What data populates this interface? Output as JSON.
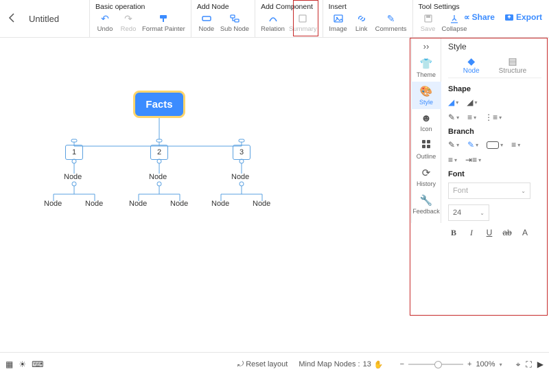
{
  "doc": {
    "title": "Untitled"
  },
  "toolbar": {
    "groups": {
      "basic": {
        "title": "Basic operation",
        "undo": "Undo",
        "redo": "Redo",
        "format_painter": "Format Painter"
      },
      "addnode": {
        "title": "Add Node",
        "node": "Node",
        "sub_node": "Sub Node"
      },
      "addcomp": {
        "title": "Add Component",
        "relation": "Relation",
        "summary": "Summary"
      },
      "insert": {
        "title": "Insert",
        "image": "Image",
        "link": "Link",
        "comments": "Comments"
      },
      "toolset": {
        "title": "Tool Settings",
        "save": "Save",
        "collapse": "Collapse"
      }
    },
    "share": "Share",
    "export": "Export"
  },
  "mindmap": {
    "root": "Facts",
    "children": [
      {
        "id": "1",
        "label": "Node",
        "children": [
          "Node",
          "Node"
        ]
      },
      {
        "id": "2",
        "label": "Node",
        "children": [
          "Node",
          "Node"
        ]
      },
      {
        "id": "3",
        "label": "Node",
        "children": [
          "Node",
          "Node"
        ]
      }
    ]
  },
  "sidetabs": {
    "theme": "Theme",
    "style": "Style",
    "icon": "Icon",
    "outline": "Outline",
    "history": "History",
    "feedback": "Feedback"
  },
  "panel": {
    "title": "Style",
    "subtabs": {
      "node": "Node",
      "structure": "Structure"
    },
    "sections": {
      "shape": "Shape",
      "branch": "Branch",
      "font": "Font"
    },
    "font_placeholder": "Font",
    "font_size": "24"
  },
  "bottom": {
    "reset_layout": "Reset layout",
    "nodes_label": "Mind Map Nodes :",
    "nodes_count": "13",
    "zoom": "100%"
  }
}
